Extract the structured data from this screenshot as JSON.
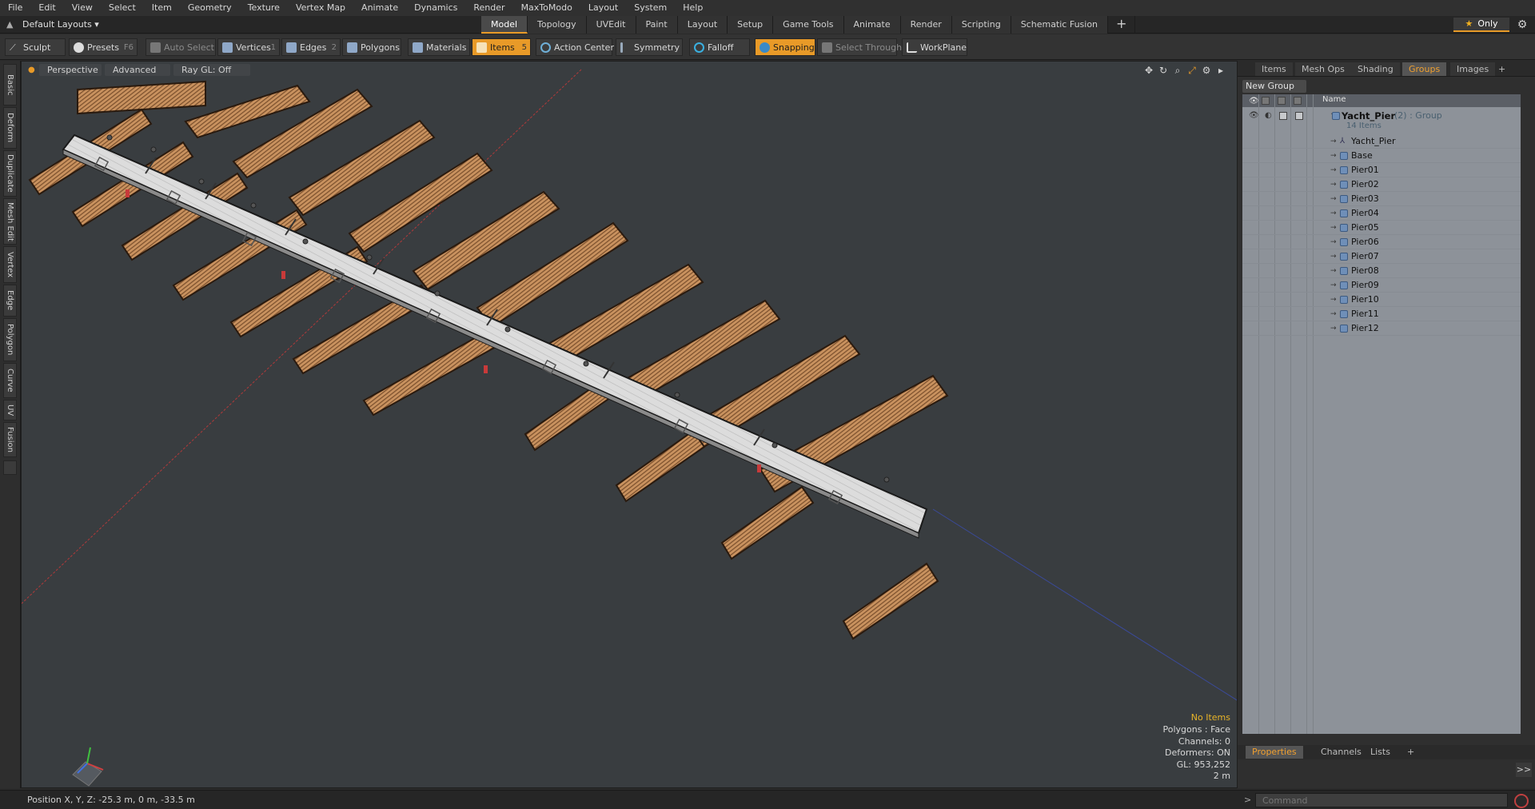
{
  "menu": [
    "File",
    "Edit",
    "View",
    "Select",
    "Item",
    "Geometry",
    "Texture",
    "Vertex Map",
    "Animate",
    "Dynamics",
    "Render",
    "MaxToModo",
    "Layout",
    "System",
    "Help"
  ],
  "layout_dropdown": "Default Layouts ▾",
  "tabs": [
    "Model",
    "Topology",
    "UVEdit",
    "Paint",
    "Layout",
    "Setup",
    "Game Tools",
    "Animate",
    "Render",
    "Scripting",
    "Schematic Fusion",
    "+"
  ],
  "only_label": "Only",
  "toolbar": {
    "sculpt": "Sculpt",
    "presets": "Presets",
    "presets_key": "F6",
    "auto_select": "Auto Select",
    "vertices": "Vertices",
    "vertices_key": "1",
    "edges": "Edges",
    "edges_key": "2",
    "polygons": "Polygons",
    "materials": "Materials",
    "items": "Items",
    "items_key": "5",
    "action_center": "Action Center",
    "symmetry": "Symmetry",
    "falloff": "Falloff",
    "snapping": "Snapping",
    "select_through": "Select Through",
    "workplane": "WorkPlane"
  },
  "left_tabs": [
    "Basic",
    "Deform",
    "Duplicate",
    "Mesh Edit",
    "Vertex",
    "Edge",
    "Polygon",
    "Curve",
    "UV",
    "Fusion"
  ],
  "viewport": {
    "perspective": "Perspective",
    "advanced": "Advanced",
    "raygl": "Ray GL: Off",
    "stats": {
      "no_items": "No Items",
      "polygons": "Polygons : Face",
      "channels": "Channels: 0",
      "deformers": "Deformers: ON",
      "gl": "GL: 953,252",
      "scale": "2 m"
    }
  },
  "right_tabs": [
    "Items",
    "Mesh Ops",
    "Shading",
    "Groups",
    "Images",
    "+"
  ],
  "new_group": "New Group",
  "list_header": "Name",
  "group": {
    "name": "Yacht_Pier",
    "count": "(2)",
    "type": ": Group",
    "subtitle": "14 Items"
  },
  "items": [
    "Yacht_Pier",
    "Base",
    "Pier01",
    "Pier02",
    "Pier03",
    "Pier04",
    "Pier05",
    "Pier06",
    "Pier07",
    "Pier08",
    "Pier09",
    "Pier10",
    "Pier11",
    "Pier12"
  ],
  "bottom_tabs": [
    "Properties",
    "Channels",
    "Lists",
    "+"
  ],
  "status": {
    "position": "Position X, Y, Z:  -25.3 m, 0 m, -33.5 m",
    "command_placeholder": "Command",
    "prompt": ">"
  },
  "colors": {
    "accent": "#e89a28",
    "wood": "#c9925f",
    "deck": "#dcdcdc",
    "viewport_bg": "#393d40"
  }
}
